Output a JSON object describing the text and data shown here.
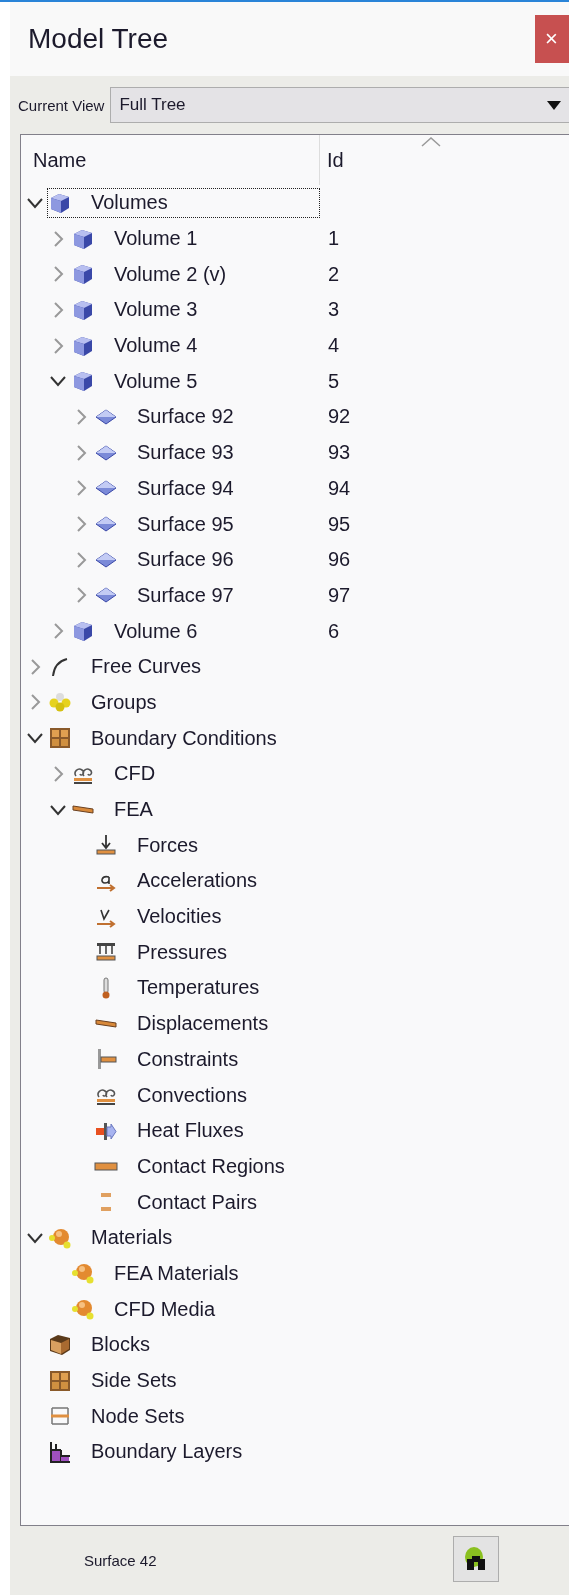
{
  "window": {
    "title": "Model Tree",
    "close_label": "×"
  },
  "view": {
    "label": "Current View",
    "value": "Full Tree"
  },
  "tree": {
    "columns": [
      "Name",
      "Id"
    ],
    "items": [
      {
        "name": "Volumes",
        "kind": "volume",
        "expanded": true,
        "focused": true,
        "children": [
          {
            "name": "Volume 1",
            "id": "1",
            "kind": "volume",
            "expanded": false
          },
          {
            "name": "Volume 2 (v)",
            "id": "2",
            "kind": "volume",
            "expanded": false
          },
          {
            "name": "Volume 3",
            "id": "3",
            "kind": "volume",
            "expanded": false
          },
          {
            "name": "Volume 4",
            "id": "4",
            "kind": "volume",
            "expanded": false
          },
          {
            "name": "Volume 5",
            "id": "5",
            "kind": "volume",
            "expanded": true,
            "children": [
              {
                "name": "Surface 92",
                "id": "92",
                "kind": "surface",
                "expanded": false
              },
              {
                "name": "Surface 93",
                "id": "93",
                "kind": "surface",
                "expanded": false
              },
              {
                "name": "Surface 94",
                "id": "94",
                "kind": "surface",
                "expanded": false
              },
              {
                "name": "Surface 95",
                "id": "95",
                "kind": "surface",
                "expanded": false
              },
              {
                "name": "Surface 96",
                "id": "96",
                "kind": "surface",
                "expanded": false
              },
              {
                "name": "Surface 97",
                "id": "97",
                "kind": "surface",
                "expanded": false
              }
            ]
          },
          {
            "name": "Volume 6",
            "id": "6",
            "kind": "volume",
            "expanded": false
          }
        ]
      },
      {
        "name": "Free Curves",
        "kind": "curve",
        "expanded": false
      },
      {
        "name": "Groups",
        "kind": "groups",
        "expanded": false
      },
      {
        "name": "Boundary Conditions",
        "kind": "grid",
        "expanded": true,
        "children": [
          {
            "name": "CFD",
            "kind": "convection",
            "expanded": false
          },
          {
            "name": "FEA",
            "kind": "displacement",
            "expanded": true,
            "children": [
              {
                "name": "Forces",
                "kind": "force"
              },
              {
                "name": "Accelerations",
                "kind": "acceleration"
              },
              {
                "name": "Velocities",
                "kind": "velocity"
              },
              {
                "name": "Pressures",
                "kind": "pressure"
              },
              {
                "name": "Temperatures",
                "kind": "temperature"
              },
              {
                "name": "Displacements",
                "kind": "displacement"
              },
              {
                "name": "Constraints",
                "kind": "constraint"
              },
              {
                "name": "Convections",
                "kind": "convection"
              },
              {
                "name": "Heat Fluxes",
                "kind": "heatflux"
              },
              {
                "name": "Contact Regions",
                "kind": "contact_region"
              },
              {
                "name": "Contact Pairs",
                "kind": "contact_pair"
              }
            ]
          }
        ]
      },
      {
        "name": "Materials",
        "kind": "material",
        "expanded": true,
        "children": [
          {
            "name": "FEA Materials",
            "kind": "material"
          },
          {
            "name": "CFD Media",
            "kind": "material"
          }
        ]
      },
      {
        "name": "Blocks",
        "kind": "block"
      },
      {
        "name": "Side Sets",
        "kind": "grid"
      },
      {
        "name": "Node Sets",
        "kind": "nodeset"
      },
      {
        "name": "Boundary Layers",
        "kind": "layers"
      }
    ]
  },
  "status_bar": {
    "text": "Surface 42"
  }
}
